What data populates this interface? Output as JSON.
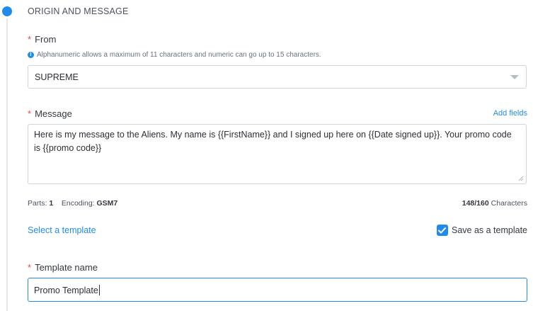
{
  "section": {
    "title": "ORIGIN AND MESSAGE"
  },
  "colors": {
    "accent": "#1f8ceb",
    "required": "#e5484d"
  },
  "from": {
    "required_mark": "*",
    "label": "From",
    "hint": "Alphanumeric allows a maximum of 11 characters and numeric can go up to 15 characters.",
    "hint_icon": "info-icon",
    "value": "SUPREME"
  },
  "message": {
    "required_mark": "*",
    "label": "Message",
    "add_fields": "Add fields",
    "value": "Here is my message to the Aliens. My name is {{FirstName}} and I signed up here on {{Date signed up}}. Your promo code is {{promo code}}"
  },
  "stats": {
    "parts_label": "Parts:",
    "parts_value": "1",
    "encoding_label": "Encoding:",
    "encoding_value": "GSM7",
    "count": "148/160",
    "count_unit": "Characters"
  },
  "template": {
    "select_link": "Select a template",
    "save_label": "Save as a template",
    "save_checked": true
  },
  "template_name": {
    "required_mark": "*",
    "label": "Template name",
    "value": "Promo Template"
  }
}
